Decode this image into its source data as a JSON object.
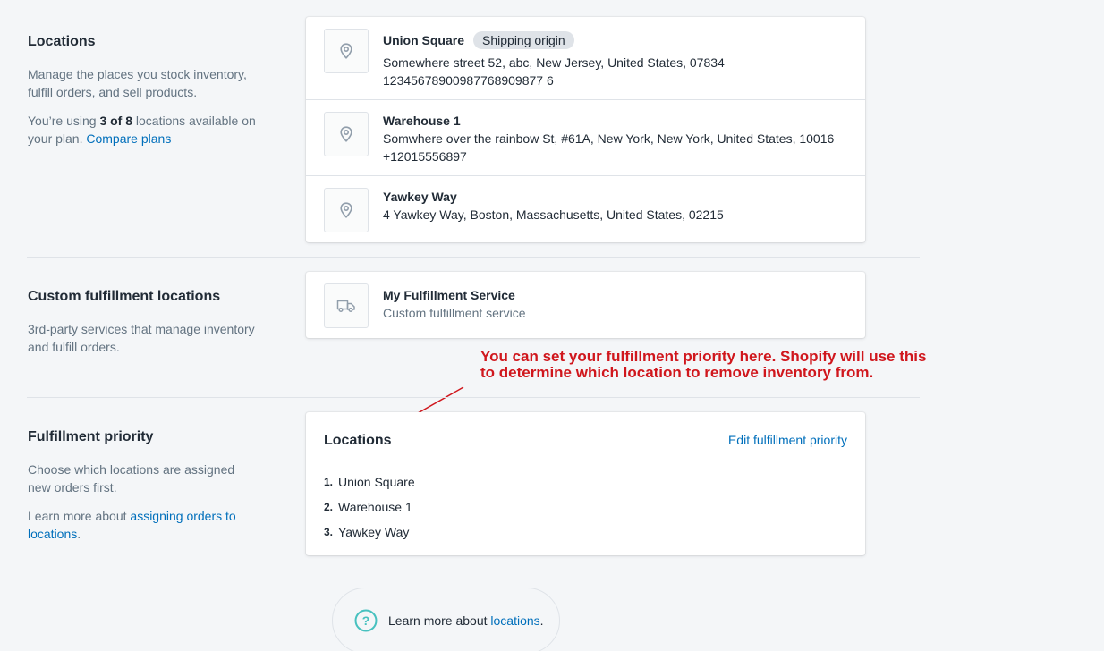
{
  "locations_section": {
    "title": "Locations",
    "description": "Manage the places you stock inventory, fulfill orders, and sell products.",
    "usage_prefix": "You’re using ",
    "usage_count": "3 of 8",
    "usage_suffix": " locations available on your plan. ",
    "compare_link": "Compare plans",
    "items": [
      {
        "name": "Union Square",
        "badge": "Shipping origin",
        "address": "Somewhere street 52, abc, New Jersey, United States, 07834",
        "phone": "12345678900987768909877 6"
      },
      {
        "name": "Warehouse 1",
        "address": "Somwhere over the rainbow St, #61A, New York, New York, United States, 10016",
        "phone": "+12015556897"
      },
      {
        "name": "Yawkey Way",
        "address": "4 Yawkey Way, Boston, Massachusetts, United States, 02215"
      }
    ]
  },
  "custom_section": {
    "title": "Custom fulfillment locations",
    "description": "3rd-party services that manage inventory and fulfill orders.",
    "service_name": "My Fulfillment Service",
    "service_type": "Custom fulfillment service"
  },
  "annotation": {
    "text": "You can set your fulfillment priority here. Shopify will use this to determine which location to remove inventory from.",
    "color": "#d0171d"
  },
  "priority_section": {
    "title": "Fulfillment priority",
    "description": "Choose which locations are assigned new orders first.",
    "learn_prefix": "Learn more about ",
    "learn_link": "assigning orders to locations",
    "learn_suffix": ".",
    "card_title": "Locations",
    "edit_link": "Edit fulfillment priority",
    "list": [
      {
        "num": "1.",
        "label": "Union Square"
      },
      {
        "num": "2.",
        "label": "Warehouse 1"
      },
      {
        "num": "3.",
        "label": "Yawkey Way"
      }
    ]
  },
  "help": {
    "prefix": "Learn more about ",
    "link": "locations",
    "suffix": ".",
    "icon": "question-circle-icon",
    "icon_color": "#47c1bf"
  },
  "colors": {
    "link": "#006fbb",
    "background": "#f4f6f8",
    "muted_text": "#637381"
  }
}
